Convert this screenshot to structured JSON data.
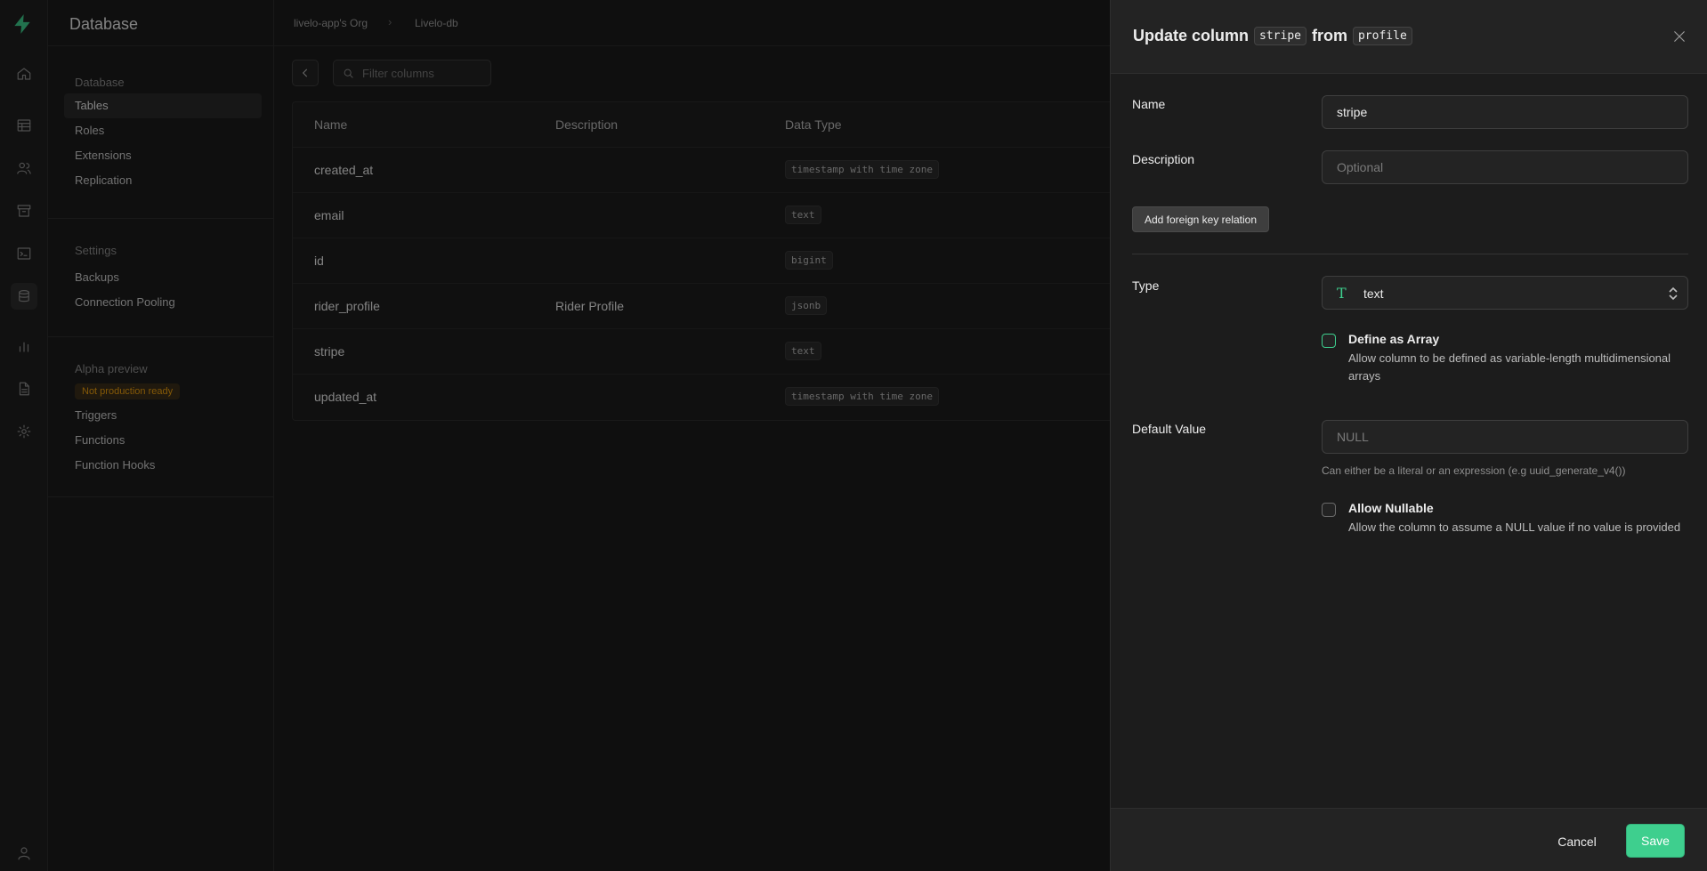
{
  "menu": {
    "title": "Database",
    "section1": {
      "heading": "Database",
      "items": [
        "Tables",
        "Roles",
        "Extensions",
        "Replication"
      ]
    },
    "section2": {
      "heading": "Settings",
      "items": [
        "Backups",
        "Connection Pooling"
      ]
    },
    "section3": {
      "heading": "Alpha preview",
      "badge": "Not production ready",
      "items": [
        "Triggers",
        "Functions",
        "Function Hooks"
      ]
    }
  },
  "breadcrumb": {
    "org": "livelo-app's Org",
    "project": "Livelo-db"
  },
  "filter": {
    "placeholder": "Filter columns"
  },
  "table": {
    "headers": [
      "Name",
      "Description",
      "Data Type"
    ],
    "rows": [
      {
        "name": "created_at",
        "description": "",
        "type": "timestamp with time zone"
      },
      {
        "name": "email",
        "description": "",
        "type": "text"
      },
      {
        "name": "id",
        "description": "",
        "type": "bigint"
      },
      {
        "name": "rider_profile",
        "description": "Rider Profile",
        "type": "jsonb"
      },
      {
        "name": "stripe",
        "description": "",
        "type": "text"
      },
      {
        "name": "updated_at",
        "description": "",
        "type": "timestamp with time zone"
      }
    ]
  },
  "panel": {
    "title_prefix": "Update column",
    "column": "stripe",
    "title_mid": "from",
    "table": "profile",
    "name_label": "Name",
    "name_value": "stripe",
    "description_label": "Description",
    "description_placeholder": "Optional",
    "fk_button": "Add foreign key relation",
    "type_label": "Type",
    "type_icon": "T",
    "type_value": "text",
    "array_title": "Define as Array",
    "array_desc": "Allow column to be defined as variable-length multidimensional arrays",
    "default_label": "Default Value",
    "default_placeholder": "NULL",
    "default_hint": "Can either be a literal or an expression (e.g uuid_generate_v4())",
    "nullable_title": "Allow Nullable",
    "nullable_desc": "Allow the column to assume a NULL value if no value is provided",
    "cancel": "Cancel",
    "save": "Save"
  },
  "colors": {
    "accent": "#3ecf8e",
    "badge": "#f1a10d"
  }
}
